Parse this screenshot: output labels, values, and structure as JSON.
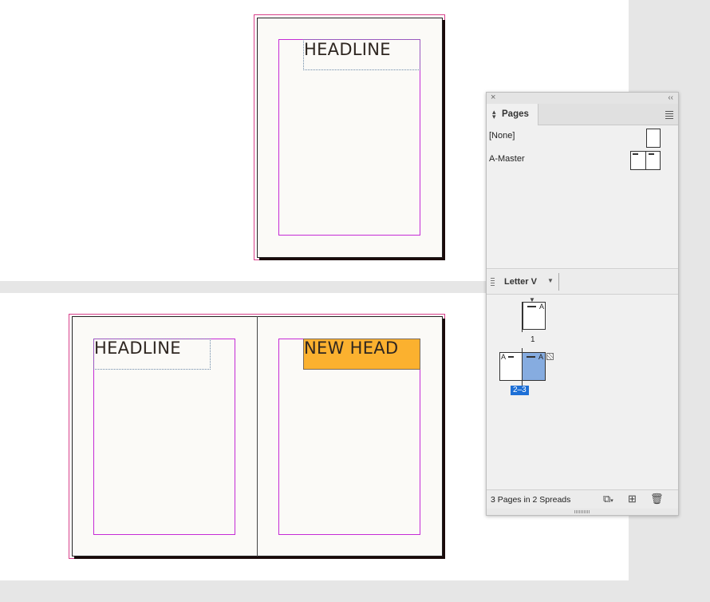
{
  "spread1": {
    "headline": "HEADLINE"
  },
  "spread2": {
    "left_headline": "HEADLINE",
    "right_headline": "NEW HEAD"
  },
  "pages_panel": {
    "close_icon": "×",
    "collapse_icon": "‹‹",
    "tab_label": "Pages",
    "masters": [
      {
        "label": "[None]"
      },
      {
        "label": "A-Master"
      }
    ],
    "page_size": "Letter V",
    "page_1_number": "1",
    "page_1_master": "A",
    "page_2_master": "A",
    "page_3_master": "A",
    "spread_2_label": "2–3",
    "status": "3 Pages in 2 Spreads"
  },
  "colors": {
    "selection_frame": "#fbb12f",
    "margin_guide": "#c52bd6",
    "bleed_guide": "#d9408a",
    "page_selected": "#86ace0",
    "range_highlight": "#1d6fd6"
  }
}
